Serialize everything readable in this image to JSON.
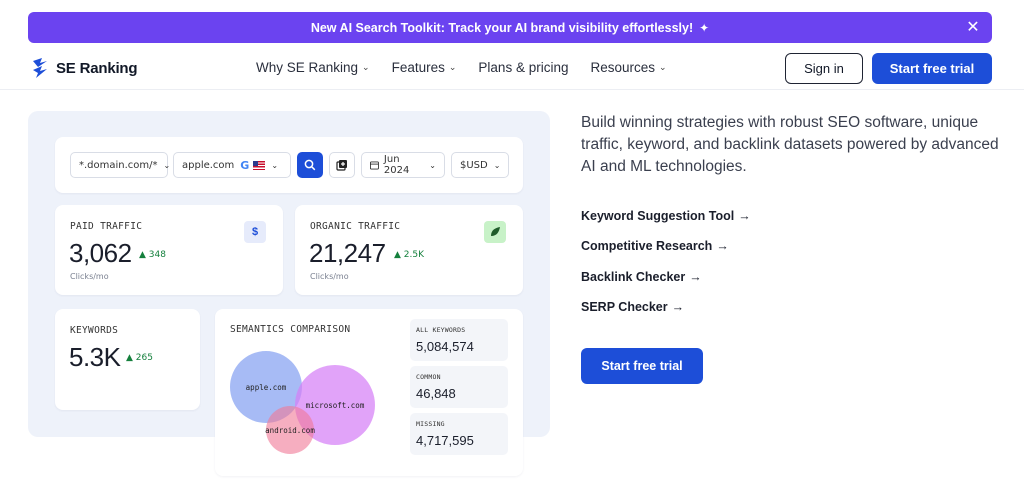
{
  "banner": {
    "text": "New AI Search Toolkit: Track your AI brand visibility effortlessly!",
    "sparkle_icon": "sparkle-icon",
    "close_icon": "close-icon"
  },
  "header": {
    "logo_text": "SE Ranking",
    "nav": [
      {
        "label": "Why SE Ranking",
        "has_dropdown": true
      },
      {
        "label": "Features",
        "has_dropdown": true
      },
      {
        "label": "Plans & pricing",
        "has_dropdown": false
      },
      {
        "label": "Resources",
        "has_dropdown": true
      }
    ],
    "sign_in": "Sign in",
    "start_trial": "Start free trial"
  },
  "dashboard": {
    "filters": {
      "domain": "*.domain.com/*",
      "query": "apple.com",
      "search_engine_icon": "google-icon",
      "country_flag_icon": "us-flag-icon",
      "date": "Jun 2024",
      "currency": "$USD"
    },
    "paid_traffic": {
      "label": "PAID TRAFFIC",
      "value": "3,062",
      "delta": "348",
      "sub": "Clicks/mo",
      "icon": "$"
    },
    "organic_traffic": {
      "label": "ORGANIC TRAFFIC",
      "value": "21,247",
      "delta": "2.5K",
      "sub": "Clicks/mo",
      "icon": "leaf-icon"
    },
    "keywords": {
      "label": "KEYWORDS",
      "value": "5.3K",
      "delta": "265"
    },
    "semantics": {
      "title": "SEMANTICS COMPARISON",
      "circles": [
        "apple.com",
        "microsoft.com",
        "android.com"
      ],
      "stats": [
        {
          "label": "ALL KEYWORDS",
          "value": "5,084,574"
        },
        {
          "label": "COMMON",
          "value": "46,848"
        },
        {
          "label": "MISSING",
          "value": "4,717,595"
        }
      ]
    }
  },
  "content": {
    "intro": "Build winning strategies with robust SEO software, unique traffic, keyword, and backlink datasets powered by advanced AI and ML technologies.",
    "links": [
      "Keyword Suggestion Tool",
      "Competitive Research",
      "Backlink Checker",
      "SERP Checker"
    ],
    "cta": "Start free trial"
  },
  "colors": {
    "banner": "#6b43f0",
    "primary": "#1d4ed8",
    "positive": "#15803d"
  }
}
